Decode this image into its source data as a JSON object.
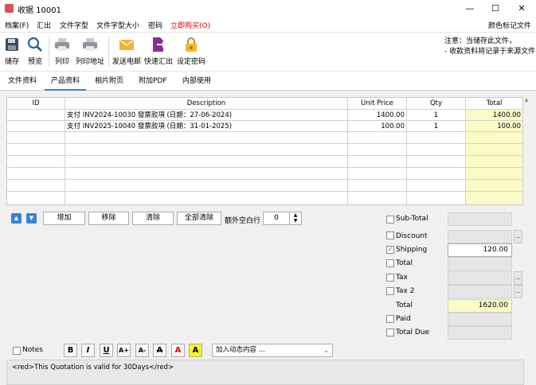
{
  "window": {
    "title": "收据 10001",
    "minimize": "—",
    "maximize": "☐",
    "close": "✕"
  },
  "menu": {
    "items": [
      "档案(F)",
      "汇出",
      "文件字型",
      "文件字型大小",
      "密码",
      "立即购买(O)"
    ],
    "right": "颜色标记文件"
  },
  "toolbar": {
    "buttons": [
      "储存",
      "预览",
      "列印",
      "列印地址",
      "发送电邮",
      "快速汇出",
      "设定密码"
    ],
    "notice_line1": "注意：当储存此文件，",
    "notice_line2": "- 收款资料将记录于来源文件"
  },
  "tabs": [
    "文件资料",
    "产品资料",
    "相片附页",
    "附加PDF",
    "内部使用"
  ],
  "grid": {
    "headers": [
      "ID",
      "Description",
      "Unit Price",
      "Qty",
      "Total"
    ],
    "rows": [
      {
        "id": "",
        "desc": "支付 INV2024-10030 發票款項 (日期：27-06-2024)",
        "price": "1400.00",
        "qty": "1",
        "total": "1400.00"
      },
      {
        "id": "",
        "desc": "支付 INV2025-10040 發票款項 (日期：31-01-2025)",
        "price": "100.00",
        "qty": "1",
        "total": "100.00"
      }
    ]
  },
  "actions": {
    "add": "增加",
    "remove": "移除",
    "clear": "清除",
    "clear_all": "全部清除",
    "blank_rows_label": "额外空白行",
    "blank_rows_value": "0"
  },
  "summary": {
    "subtotal": {
      "label": "Sub-Total",
      "value": ""
    },
    "discount": {
      "label": "Discount",
      "value": ""
    },
    "shipping": {
      "label": "Shipping",
      "value": "120.00",
      "checked": "✓"
    },
    "total_cb": {
      "label": "Total",
      "value": ""
    },
    "tax": {
      "label": "Tax",
      "value": ""
    },
    "tax2": {
      "label": "Tax 2",
      "value": ""
    },
    "grand_total": {
      "label": "Total",
      "value": "1620.00"
    },
    "paid": {
      "label": "Paid",
      "value": ""
    },
    "total_due": {
      "label": "Total Due",
      "value": ""
    }
  },
  "notes": {
    "label": "Notes",
    "format_buttons": [
      "B",
      "I",
      "U",
      "A+",
      "A-",
      "A",
      "A",
      "A"
    ],
    "dynamic_placeholder": "加入动态内容 ...",
    "memo": "<red>This Quotation is valid for 30Days</red>"
  },
  "colors": {
    "accent": "#3c7fc7",
    "total_bg": "#fbfbc8",
    "buy_red": "#e00000"
  }
}
